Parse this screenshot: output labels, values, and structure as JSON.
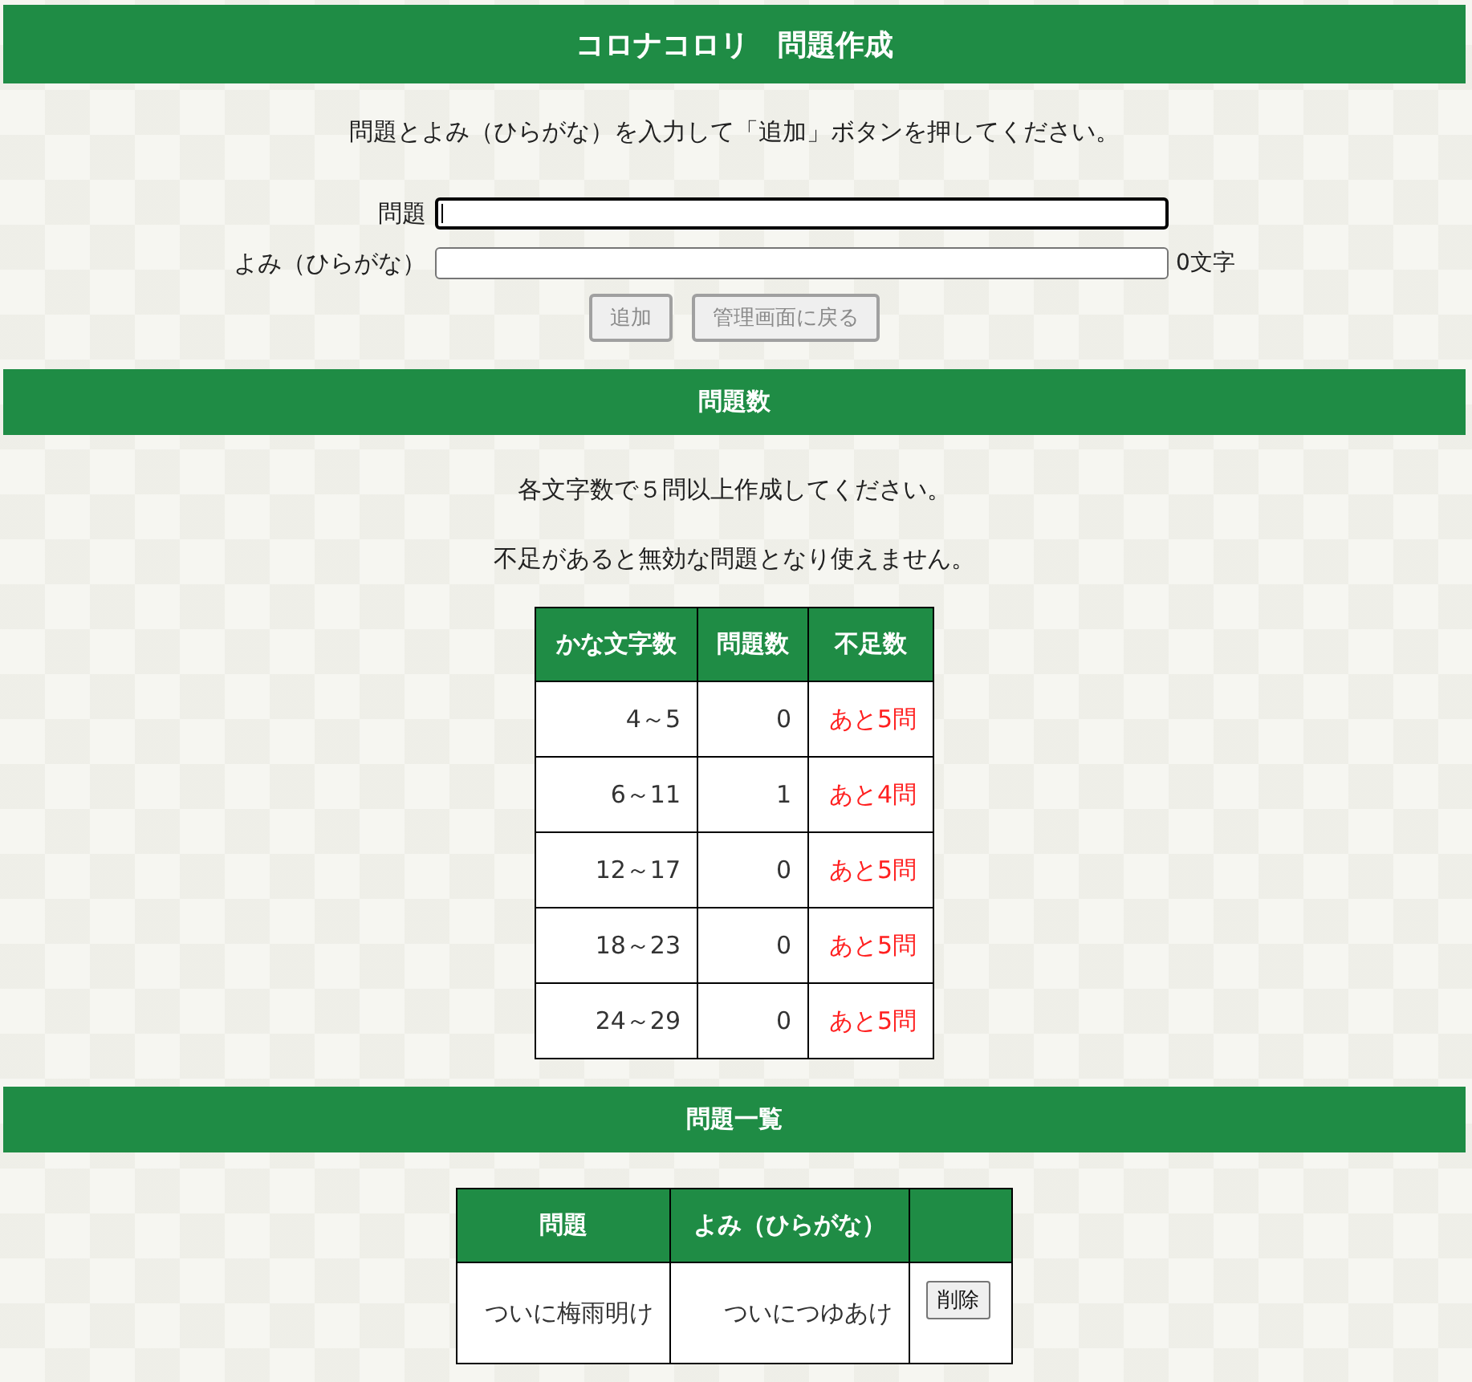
{
  "header": {
    "title": "コロナコロリ　問題作成"
  },
  "instruction": "問題とよみ（ひらがな）を入力して「追加」ボタンを押してください。",
  "form": {
    "fields": [
      {
        "label": "問題",
        "focused": true
      },
      {
        "label": "よみ（ひらがな）",
        "focused": false,
        "counter": "0文字"
      }
    ],
    "buttons": [
      {
        "label": "追加",
        "disabled": true
      },
      {
        "label": "管理画面に戻る",
        "disabled": true
      }
    ]
  },
  "count_section": {
    "title": "問題数",
    "notes": [
      "各文字数で５問以上作成してください。",
      "不足があると無効な問題となり使えません。"
    ],
    "table": {
      "columns": [
        "かな文字数",
        "問題数",
        "不足数"
      ],
      "rows": [
        {
          "range": "4～5",
          "count": "0",
          "shortage": "あと5問"
        },
        {
          "range": "6～11",
          "count": "1",
          "shortage": "あと4問"
        },
        {
          "range": "12～17",
          "count": "0",
          "shortage": "あと5問"
        },
        {
          "range": "18～23",
          "count": "0",
          "shortage": "あと5問"
        },
        {
          "range": "24～29",
          "count": "0",
          "shortage": "あと5問"
        }
      ]
    }
  },
  "list_section": {
    "title": "問題一覧",
    "table": {
      "columns": [
        "問題",
        "よみ（ひらがな）"
      ],
      "rows": [
        {
          "question": "ついに梅雨明け",
          "reading": "ついにつゆあけ",
          "action": "削除"
        }
      ]
    }
  }
}
